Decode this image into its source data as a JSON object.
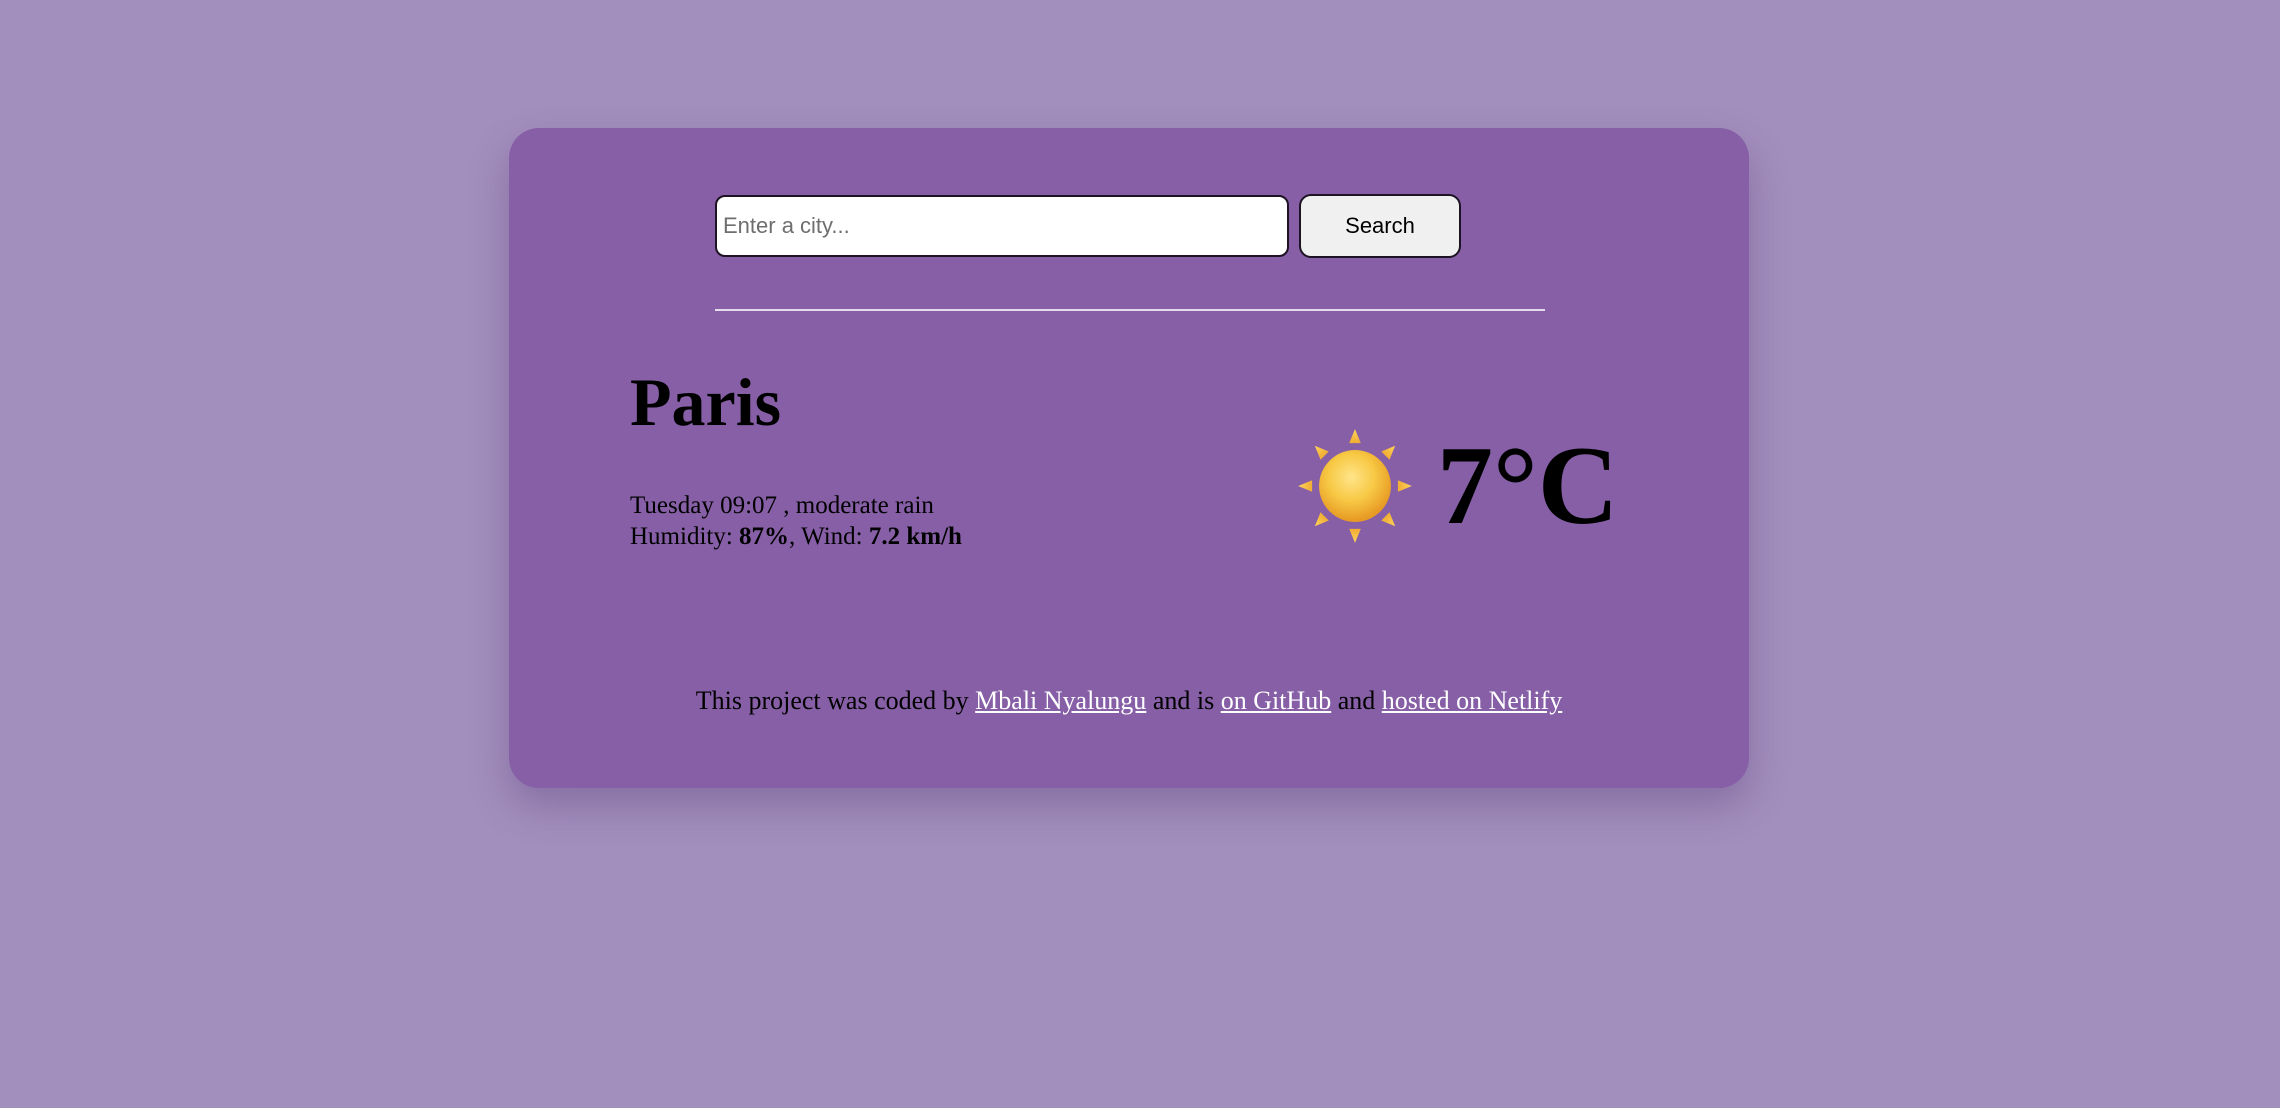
{
  "search": {
    "placeholder": "Enter a city...",
    "value": "",
    "button_label": "Search"
  },
  "weather": {
    "city": "Paris",
    "day_time": "Tuesday 09:07",
    "separator": " , ",
    "description": "moderate rain",
    "humidity_label": "Humidity: ",
    "humidity_value": "87%",
    "wind_label": ", Wind: ",
    "wind_value": "7.2 km/h",
    "temperature": "7°C",
    "icon": "sun-icon"
  },
  "footer": {
    "prefix": "This project was coded by ",
    "author_link": "Mbali Nyalungu",
    "middle": " and is ",
    "github_link": "on GitHub",
    "and": " and ",
    "netlify_link": "hosted on Netlify"
  },
  "colors": {
    "page_background": "#a38fbe",
    "card_background": "#865fa6",
    "link": "#ffffff"
  }
}
